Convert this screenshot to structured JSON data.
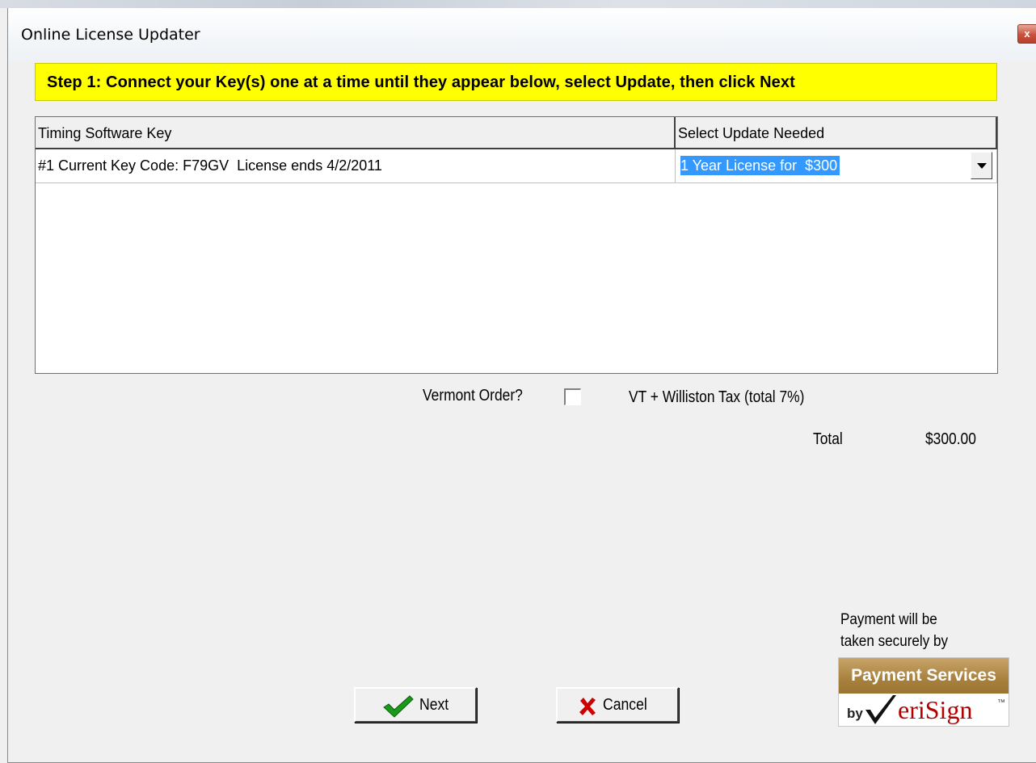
{
  "window": {
    "title": "Online License Updater",
    "close_glyph": "x"
  },
  "banner": {
    "text": "Step 1: Connect your Key(s) one at a time until they appear below, select Update, then click Next"
  },
  "grid": {
    "columns": [
      "Timing Software Key",
      "Select Update Needed"
    ],
    "rows": [
      {
        "key": "#1 Current Key Code: F79GV  License ends 4/2/2011",
        "update": "1 Year License for  $300"
      }
    ]
  },
  "order": {
    "vermont_label": "Vermont Order?",
    "vermont_checked": false,
    "tax_label": "VT + Williston Tax (total 7%)",
    "total_label": "Total",
    "total_value": "$300.00"
  },
  "payment": {
    "note_line1": "Payment will be",
    "note_line2": "taken securely by",
    "badge_top": "Payment Services",
    "badge_by": "by",
    "badge_brand": "eriSign",
    "badge_tm": "™"
  },
  "buttons": {
    "next_label": "Next",
    "cancel_label": "Cancel"
  },
  "colors": {
    "banner": "#ffff00",
    "selection": "#3399ff",
    "next_icon": "#1a9a1a",
    "cancel_icon": "#cc0000",
    "verisign_gold": "#a8813e",
    "verisign_red": "#b40000"
  },
  "icons": {
    "next": "checkmark-icon",
    "cancel": "x-icon",
    "dropdown": "chevron-down-icon",
    "close": "close-icon"
  }
}
